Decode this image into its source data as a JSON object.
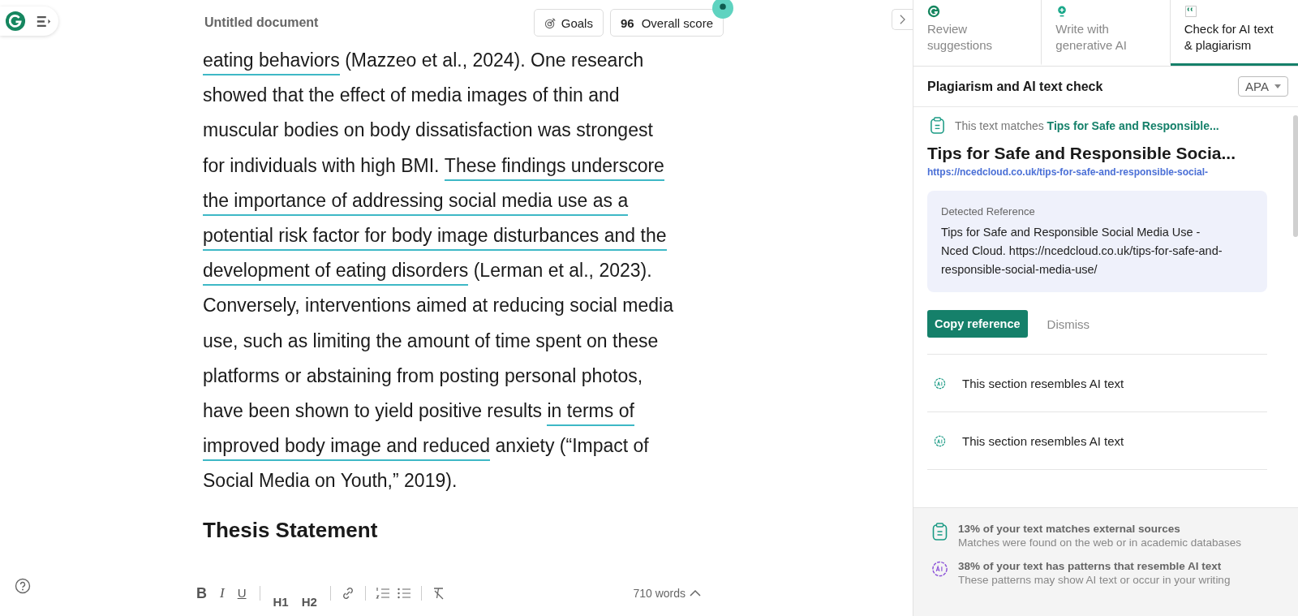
{
  "header": {
    "title": "Untitled document",
    "goals_label": "Goals",
    "score": "96",
    "score_label": "Overall score"
  },
  "document": {
    "lines": [
      [
        {
          "text": "eating behaviors",
          "underlined": true
        },
        {
          "text": " (Mazzeo et al., 2024). One research",
          "underlined": false
        }
      ],
      [
        {
          "text": "showed that the effect of media images of thin and",
          "underlined": false
        }
      ],
      [
        {
          "text": "muscular bodies on body dissatisfaction was strongest",
          "underlined": false
        }
      ],
      [
        {
          "text": "for individuals with high BMI. ",
          "underlined": false
        },
        {
          "text": "These findings underscore",
          "underlined": true
        }
      ],
      [
        {
          "text": "the importance of addressing social ",
          "underlined": true
        },
        {
          "text": "media use as a",
          "underlined": true
        }
      ],
      [
        {
          "text": "potential risk factor for ",
          "underlined": true
        },
        {
          "text": "body image disturbances and the",
          "underlined": true
        }
      ],
      [
        {
          "text": "development of eating disorders",
          "underlined": true
        },
        {
          "text": " (Lerman et al., 2023).",
          "underlined": false
        }
      ],
      [
        {
          "text": "Conversely, interventions aimed at reducing social media",
          "underlined": false
        }
      ],
      [
        {
          "text": "use, such as limiting the amount of time spent on these",
          "underlined": false
        }
      ],
      [
        {
          "text": "platforms or abstaining from posting personal photos,",
          "underlined": false
        }
      ],
      [
        {
          "text": "have been shown to yield positive results ",
          "underlined": false
        },
        {
          "text": "in terms of",
          "underlined": true
        }
      ],
      [
        {
          "text": "improved body image and reduced",
          "underlined": true
        },
        {
          "text": " anxiety (“Impact of",
          "underlined": false
        }
      ],
      [
        {
          "text": "Social Media on Youth,” 2019).",
          "underlined": false
        }
      ]
    ],
    "heading": "Thesis Statement"
  },
  "toolbar": {
    "buttons": [
      {
        "label": "B",
        "kind": "bold"
      },
      {
        "label": "I",
        "kind": "italic"
      },
      {
        "label": "U",
        "kind": "underline"
      },
      {
        "label": "H1",
        "kind": "heading"
      },
      {
        "label": "H2",
        "kind": "heading"
      }
    ],
    "word_count": "710 words"
  },
  "tabs": [
    {
      "label": "Review suggestions",
      "kind": "review",
      "selected": false
    },
    {
      "label": "Write with generative AI",
      "kind": "write",
      "selected": false
    },
    {
      "label": "Check for AI text & plagiarism",
      "kind": "check",
      "selected": true
    }
  ],
  "panel": {
    "title": "Plagiarism and AI text check",
    "citation_style": "APA",
    "match": {
      "prefix": "This text matches",
      "source_short": "Tips for Safe and Responsible...",
      "title": "Tips for Safe and Responsible Socia...",
      "url": "https://ncedcloud.co.uk/tips-for-safe-and-responsible-social-",
      "reference_label": "Detected Reference",
      "reference": "Tips for Safe and Responsible Social Media Use - Nced Cloud. https://ncedcloud.co.uk/tips-for-safe-and-responsible-social-media-use/",
      "copy_button": "Copy reference",
      "dismiss_button": "Dismiss"
    },
    "ai_sections": [
      "This section resembles AI text",
      "This section resembles AI text"
    ],
    "summary": [
      {
        "kind": "plagiarism",
        "title": "13% of your text matches external sources",
        "detail": "Matches were found on the web or in academic databases"
      },
      {
        "kind": "ai",
        "title": "38% of your text has patterns that resemble AI text",
        "detail": "These patterns may show AI text or occur in your writing"
      }
    ]
  }
}
